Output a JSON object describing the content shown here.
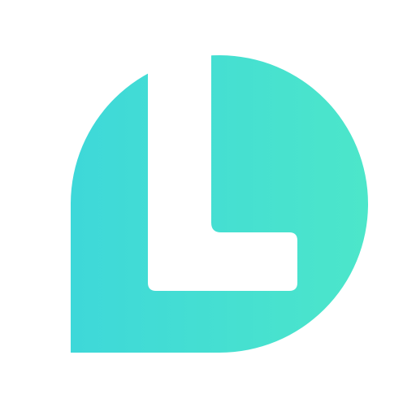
{
  "app": {
    "icon_name": "l-chat-bubble-logo-icon"
  },
  "colors": {
    "background": "#ffffff",
    "gradient_start": "#3ED8D9",
    "gradient_end": "#4CE6CA",
    "cutout": "#ffffff"
  }
}
